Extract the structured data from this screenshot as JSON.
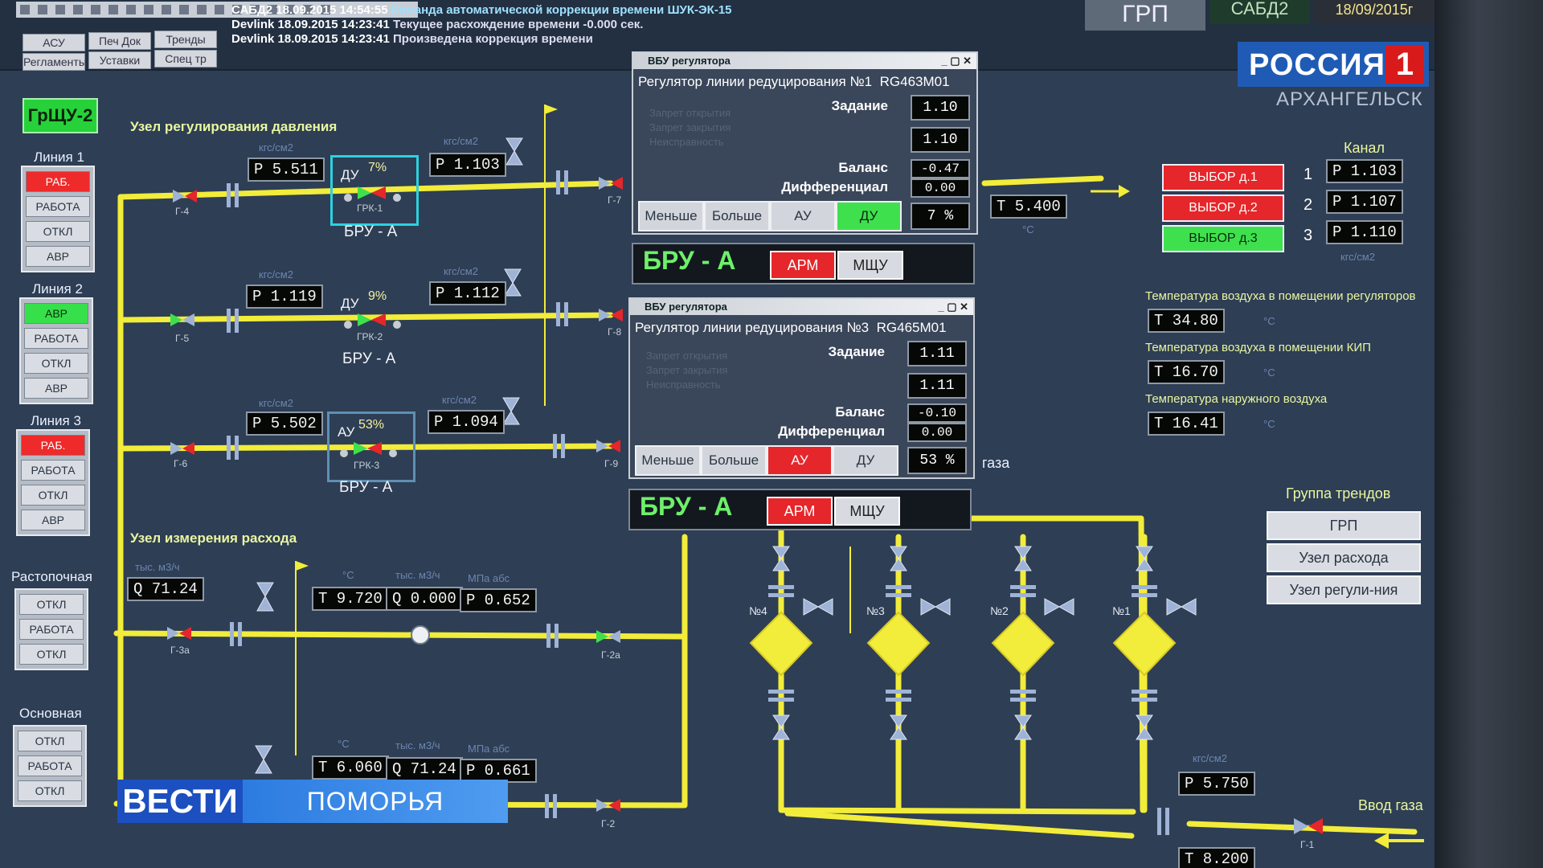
{
  "toolbar": {
    "tabs": [
      "АСУ",
      "Печ Док",
      "Тренды",
      "Регламенты",
      "Уставки",
      "Спец тр"
    ]
  },
  "log": [
    {
      "src": "САБД2",
      "time": "18.09.2015 14:54:55",
      "msg": "Команда автоматической коррекции времени ШУК-ЭК-15"
    },
    {
      "src": "Devlink",
      "time": "18.09.2015 14:23:41",
      "msg": "Текущее расхождение времени -0.000 сек."
    },
    {
      "src": "Devlink",
      "time": "18.09.2015 14:23:41",
      "msg": "Произведена коррекция времени"
    }
  ],
  "header": {
    "grp": "ГРП",
    "sabd": "САБД2",
    "date": "18/09/2015г"
  },
  "overlay": {
    "channel": "РОССИЯ",
    "channel_num": "1",
    "city": "АРХАНГЕЛЬСК",
    "news": "ВЕСТИ",
    "region": "ПОМОРЬЯ"
  },
  "main": {
    "grshu": "ГрЩУ-2",
    "pressure_node": "Узел регулирования давления",
    "flow_node": "Узел измерения расхода",
    "gas_label": "газа",
    "gas_input": "Ввод газа"
  },
  "left_panels": [
    {
      "title": "Линия 1",
      "buttons": [
        {
          "label": "РАБ.",
          "state": "red"
        },
        {
          "label": "РАБОТА",
          "state": "gray"
        },
        {
          "label": "ОТКЛ",
          "state": "gray"
        },
        {
          "label": "АВР",
          "state": "gray"
        }
      ]
    },
    {
      "title": "Линия 2",
      "buttons": [
        {
          "label": "АВР",
          "state": "green"
        },
        {
          "label": "РАБОТА",
          "state": "gray"
        },
        {
          "label": "ОТКЛ",
          "state": "gray"
        },
        {
          "label": "АВР",
          "state": "gray"
        }
      ]
    },
    {
      "title": "Линия 3",
      "buttons": [
        {
          "label": "РАБ.",
          "state": "red"
        },
        {
          "label": "РАБОТА",
          "state": "gray"
        },
        {
          "label": "ОТКЛ",
          "state": "gray"
        },
        {
          "label": "АВР",
          "state": "gray"
        }
      ]
    },
    {
      "title": "Растопочная",
      "buttons": [
        {
          "label": "ОТКЛ",
          "state": "gray"
        },
        {
          "label": "РАБОТА",
          "state": "gray"
        },
        {
          "label": "ОТКЛ",
          "state": "gray"
        }
      ]
    },
    {
      "title": "Основная",
      "buttons": [
        {
          "label": "ОТКЛ",
          "state": "gray"
        },
        {
          "label": "РАБОТА",
          "state": "gray"
        },
        {
          "label": "ОТКЛ",
          "state": "gray"
        }
      ]
    }
  ],
  "lines": [
    {
      "p_in": "P 5.511",
      "p_out": "P 1.103",
      "mode": "ДУ",
      "pct": "7%",
      "grk": "ГРК-1",
      "bru": "БРУ - А",
      "v_in": "Г-4",
      "v_out": "Г-7"
    },
    {
      "p_in": "P 1.119",
      "p_out": "P 1.112",
      "mode": "ДУ",
      "pct": "9%",
      "grk": "ГРК-2",
      "bru": "БРУ - А",
      "v_in": "Г-5",
      "v_out": "Г-8"
    },
    {
      "p_in": "P 5.502",
      "p_out": "P 1.094",
      "mode": "АУ",
      "pct": "53%",
      "grk": "ГРК-3",
      "bru": "БРУ - А",
      "v_in": "Г-6",
      "v_out": "Г-9"
    }
  ],
  "units": {
    "p": "кгс/см2",
    "t": "°C",
    "q": "тыс. м3/ч",
    "mpa": "МПа абс"
  },
  "flow": {
    "q_left": "Q 71.24",
    "row1": {
      "t": "T 9.720",
      "q": "Q 0.000",
      "p": "P 0.652",
      "v_in": "Г-3а",
      "v_out": "Г-2а"
    },
    "row2": {
      "t": "T 6.060",
      "q": "Q 71.24",
      "p": "P 0.661",
      "v_out": "Г-2"
    }
  },
  "out_temp": "T 5.400",
  "dialogs": [
    {
      "window": "ВБУ регулятора",
      "title": "Регулятор линии редуцирования №1",
      "id": "RG463M01",
      "ghost": [
        "Запрет открытия",
        "Запрет закрытия",
        "Неисправность"
      ],
      "zadanie_label": "Задание",
      "zadanie": "1.10",
      "value2": "1.10",
      "balans_label": "Баланс",
      "balans": "-0.47",
      "diff_label": "Дифференциал",
      "diff": "0.00",
      "btn_less": "Меньше",
      "btn_more": "Больше",
      "btn_au": "АУ",
      "btn_du": "ДУ",
      "pct": "7 %",
      "bru": "БРУ - А",
      "arm": "АРМ",
      "mshu": "МЩУ"
    },
    {
      "window": "ВБУ регулятора",
      "title": "Регулятор линии редуцирования №3",
      "id": "RG465M01",
      "ghost": [
        "Запрет открытия",
        "Запрет закрытия",
        "Неисправность"
      ],
      "zadanie_label": "Задание",
      "zadanie": "1.11",
      "value2": "1.11",
      "balans_label": "Баланс",
      "balans": "-0.10",
      "diff_label": "Дифференциал",
      "diff": "0.00",
      "btn_less": "Меньше",
      "btn_more": "Больше",
      "btn_au": "АУ",
      "btn_du": "ДУ",
      "pct": "53 %",
      "bru": "БРУ - А",
      "arm": "АРМ",
      "mshu": "МЩУ"
    }
  ],
  "channels": {
    "title": "Канал",
    "items": [
      {
        "num": "1",
        "select": "ВЫБОР д.1",
        "state": "red",
        "p": "P 1.103"
      },
      {
        "num": "2",
        "select": "ВЫБОР д.2",
        "state": "red",
        "p": "P 1.107"
      },
      {
        "num": "3",
        "select": "ВЫБОР д.3",
        "state": "green",
        "p": "P 1.110"
      }
    ],
    "unit": "кгс/см2"
  },
  "temps": [
    {
      "label": "Температура воздуха в помещении регуляторов",
      "value": "T 34.80"
    },
    {
      "label": "Температура воздуха в помещении КИП",
      "value": "T 16.70"
    },
    {
      "label": "Температура наружного воздуха",
      "value": "T 16.41"
    }
  ],
  "trends": {
    "title": "Группа трендов",
    "buttons": [
      "ГРП",
      "Узел расхода",
      "Узел регули-ния"
    ]
  },
  "filters": [
    "№4",
    "№3",
    "№2",
    "№1"
  ],
  "inlet": {
    "unit": "кгс/см2",
    "p": "P 5.750",
    "t": "T 8.200",
    "valve": "Г-1"
  },
  "colors": {
    "pipe": "#f2ec3a",
    "screen_bg": "#2e3e54",
    "alarm": "#e5262a",
    "ok": "#3fe04e"
  }
}
